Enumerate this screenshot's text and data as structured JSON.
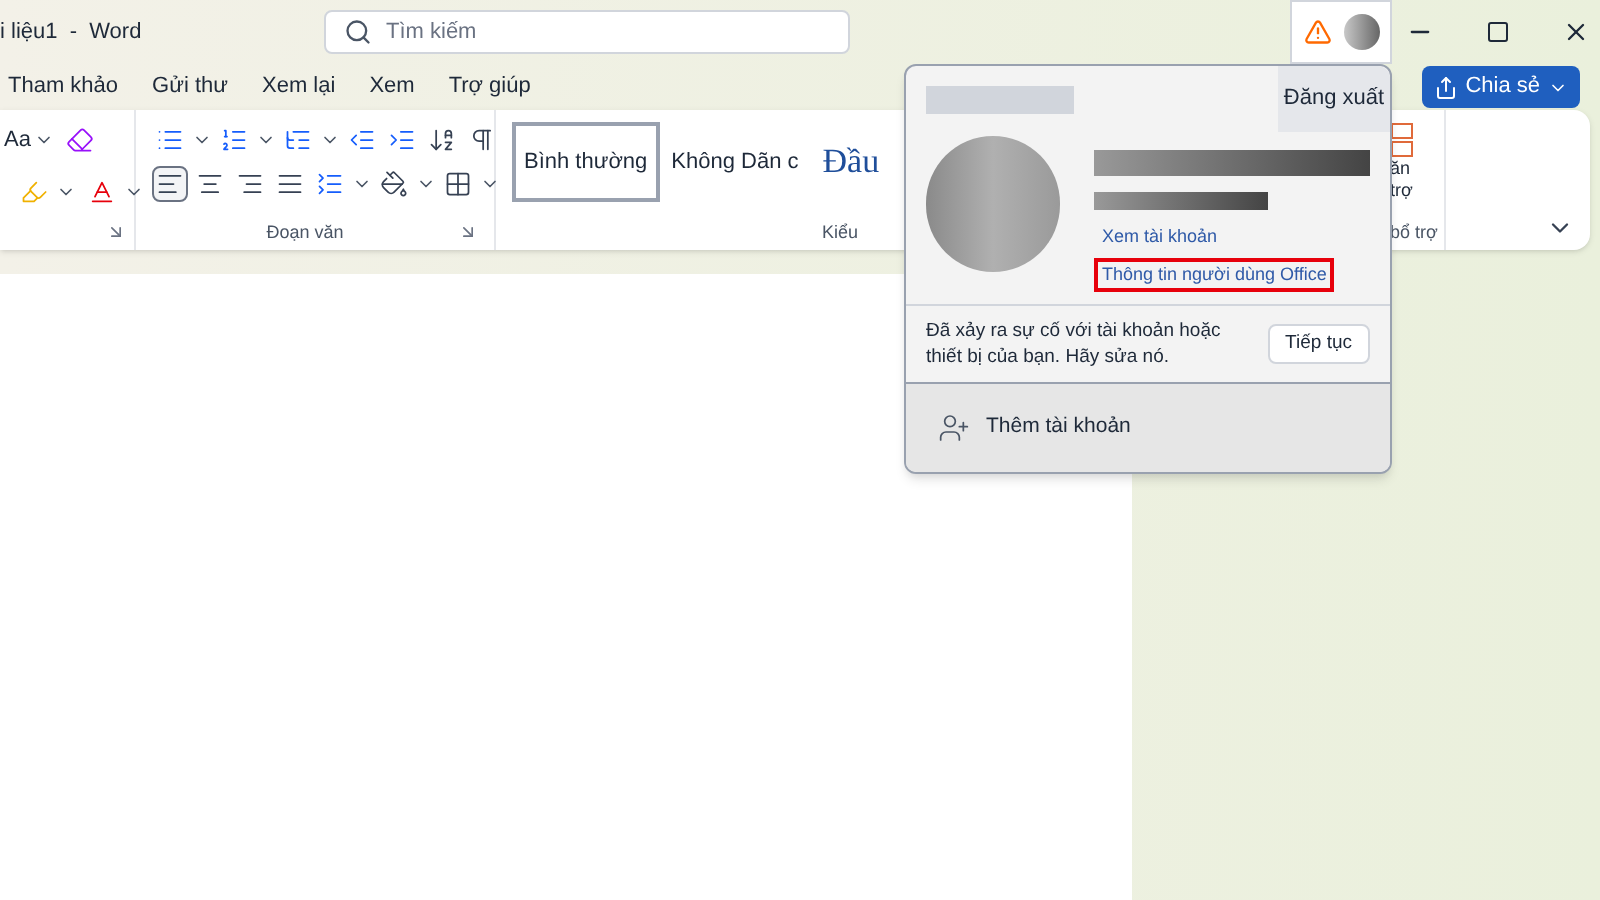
{
  "window": {
    "title": "i liệu1  -  Word"
  },
  "search": {
    "placeholder": "Tìm kiếm"
  },
  "tabs": [
    {
      "label": "Tham khảo",
      "selected": false
    },
    {
      "label": "Gửi thư",
      "selected": false
    },
    {
      "label": "Xem lại",
      "selected": false
    },
    {
      "label": "Xem",
      "selected": false
    },
    {
      "label": "Trợ giúp",
      "selected": false
    }
  ],
  "share_button": "Chia sẻ",
  "ribbon": {
    "font_group": {
      "case_button": "Aa"
    },
    "paragraph_group": {
      "label": "Đoạn văn",
      "align_buttons": [
        {
          "kind": "left",
          "selected": true
        },
        {
          "kind": "center",
          "selected": false
        },
        {
          "kind": "right",
          "selected": false
        },
        {
          "kind": "justify",
          "selected": false
        }
      ]
    },
    "styles_group": {
      "label": "Kiểu",
      "styles": [
        {
          "label": "Bình thường",
          "selected": true,
          "kind": "normal"
        },
        {
          "label": "Không Dãn c",
          "selected": false,
          "kind": "normal"
        },
        {
          "label": "Đầu",
          "selected": false,
          "kind": "heading"
        }
      ]
    },
    "addin_group": {
      "label": "bổ trợ",
      "button_lines": [
        "ăn",
        "trợ"
      ]
    }
  },
  "account_popup": {
    "sign_out": "Đăng xuất",
    "links": [
      {
        "label": "Xem tài khoản",
        "highlighted": false
      },
      {
        "label": "Thông tin người dùng Office",
        "highlighted": true
      }
    ],
    "warning": {
      "message": "Đã xảy ra sự cố với tài khoản hoặc thiết bị của bạn. Hãy sửa nó.",
      "button": "Tiếp tục"
    },
    "add_account": "Thêm tài khoản"
  }
}
